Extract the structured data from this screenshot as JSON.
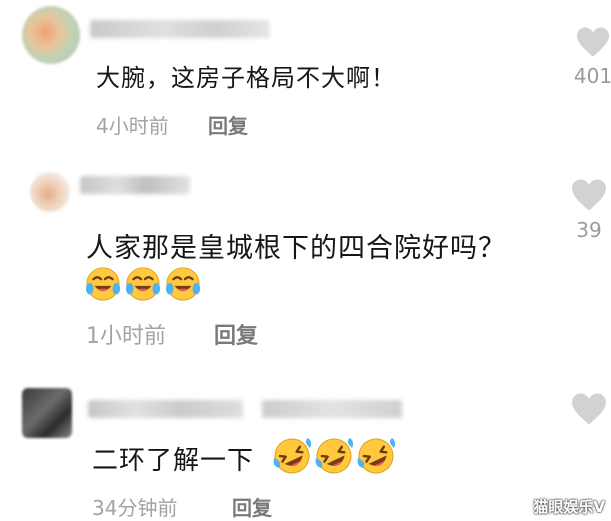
{
  "comments": [
    {
      "text": "大腕，这房子格局不大啊！",
      "time": "4小时前",
      "reply_label": "回复",
      "likes": "401",
      "emoji_count": 0
    },
    {
      "text": "人家那是皇城根下的四合院好吗？",
      "time": "1小时前",
      "reply_label": "回复",
      "likes": "39",
      "emoji_count": 3,
      "emoji": "laughing-tears-icon"
    },
    {
      "text": "二环了解一下",
      "time": "34分钟前",
      "reply_label": "回复",
      "likes": "",
      "emoji_count": 3,
      "emoji": "rolling-laughing-icon"
    }
  ],
  "watermark": "猫眼娱乐V",
  "colors": {
    "text": "#161616",
    "meta": "#a3a3a3",
    "reply": "#7a7a7a",
    "heart": "#d2d2d2",
    "emoji_yellow": "#ffc83d"
  }
}
